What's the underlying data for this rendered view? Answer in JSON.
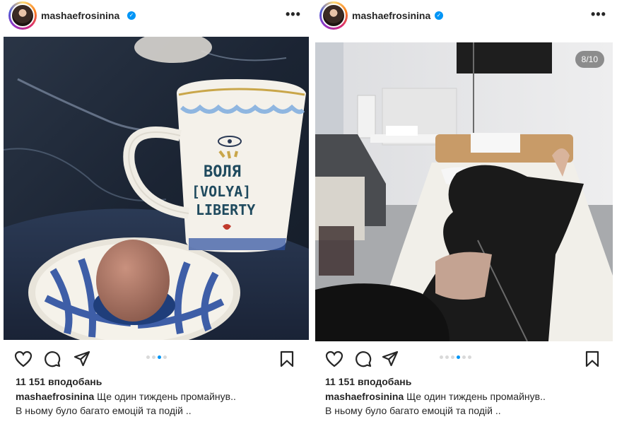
{
  "left_post": {
    "username": "mashaefrosinina",
    "verified": true,
    "photo_text": {
      "line1": "ВОЛЯ",
      "line2": "[VOLYA]",
      "line3": "LIBERTY"
    },
    "carousel_active_index": 2,
    "carousel_dot_count": 4,
    "likes": "11 151 вподобань",
    "caption_username": "mashaefrosinina",
    "caption_text": "Ще один тиждень промайнув..",
    "caption_line2": "В ньому було багато емоцій та подій .."
  },
  "right_post": {
    "username": "mashaefrosinina",
    "verified": true,
    "counter": "8/10",
    "carousel_active_index": 3,
    "carousel_dot_count": 6,
    "likes": "11 151 вподобань",
    "caption_username": "mashaefrosinina",
    "caption_text": "Ще один тиждень промайнув..",
    "caption_line2": "В ньому було багато емоцій та подій .."
  },
  "icons": {
    "like": "heart-icon",
    "comment": "comment-icon",
    "share": "paper-plane-icon",
    "save": "bookmark-icon",
    "more": "more-options-icon",
    "verified": "verified-badge-icon"
  },
  "colors": {
    "verified": "#0095f6",
    "active_dot": "#0095f6",
    "text": "#262626"
  }
}
